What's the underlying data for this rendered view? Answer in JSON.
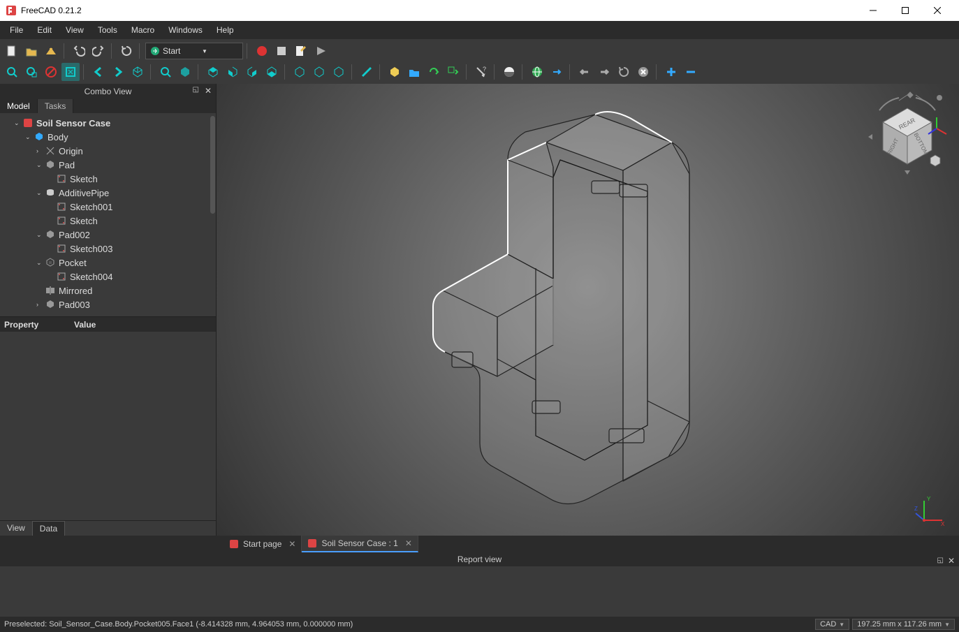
{
  "title": "FreeCAD 0.21.2",
  "menu": [
    "File",
    "Edit",
    "View",
    "Tools",
    "Macro",
    "Windows",
    "Help"
  ],
  "workbench": "Start",
  "combo_view_title": "Combo View",
  "combo_tabs": [
    "Model",
    "Tasks"
  ],
  "tree": {
    "root": "Soil Sensor Case",
    "body": "Body",
    "items": [
      {
        "label": "Origin",
        "indent": 3,
        "toggle": "›",
        "icon": "origin"
      },
      {
        "label": "Pad",
        "indent": 3,
        "toggle": "⌄",
        "icon": "pad"
      },
      {
        "label": "Sketch",
        "indent": 4,
        "toggle": "",
        "icon": "sketch"
      },
      {
        "label": "AdditivePipe",
        "indent": 3,
        "toggle": "⌄",
        "icon": "pipe"
      },
      {
        "label": "Sketch001",
        "indent": 4,
        "toggle": "",
        "icon": "sketch"
      },
      {
        "label": "Sketch",
        "indent": 4,
        "toggle": "",
        "icon": "sketch"
      },
      {
        "label": "Pad002",
        "indent": 3,
        "toggle": "⌄",
        "icon": "pad"
      },
      {
        "label": "Sketch003",
        "indent": 4,
        "toggle": "",
        "icon": "sketch"
      },
      {
        "label": "Pocket",
        "indent": 3,
        "toggle": "⌄",
        "icon": "pocket"
      },
      {
        "label": "Sketch004",
        "indent": 4,
        "toggle": "",
        "icon": "sketch"
      },
      {
        "label": "Mirrored",
        "indent": 3,
        "toggle": "",
        "icon": "mirror"
      },
      {
        "label": "Pad003",
        "indent": 3,
        "toggle": "›",
        "icon": "pad"
      }
    ]
  },
  "prop_cols": [
    "Property",
    "Value"
  ],
  "bottom_tabs": [
    "View",
    "Data"
  ],
  "doc_tabs": [
    {
      "label": "Start page",
      "active": false
    },
    {
      "label": "Soil Sensor Case : 1",
      "active": true
    }
  ],
  "report_title": "Report view",
  "status_text": "Preselected: Soil_Sensor_Case.Body.Pocket005.Face1 (-8.414328 mm, 4.964053 mm, 0.000000 mm)",
  "status_mode": "CAD",
  "status_dims": "197.25 mm x 117.26 mm",
  "navcube": {
    "top": "REAR",
    "right": "BOTTOM",
    "front": "RIGHT"
  }
}
